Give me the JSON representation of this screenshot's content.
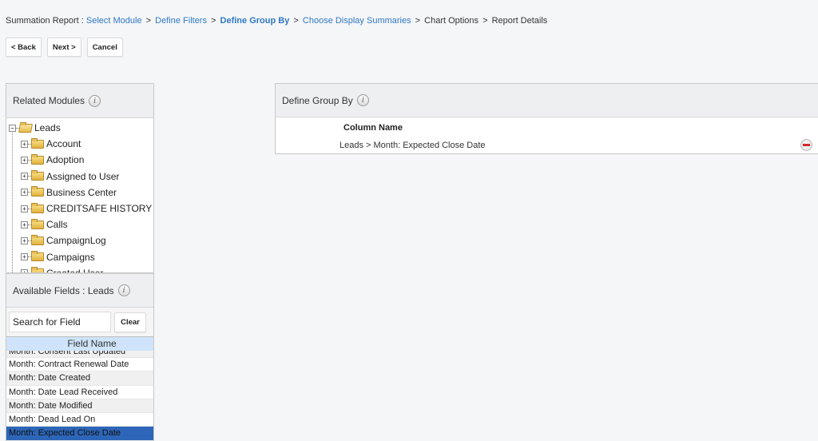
{
  "breadcrumb": {
    "prefix": "Summation Report :",
    "steps": [
      {
        "label": "Select Module",
        "state": "link"
      },
      {
        "label": "Define Filters",
        "state": "link"
      },
      {
        "label": "Define Group By",
        "state": "current"
      },
      {
        "label": "Choose Display Summaries",
        "state": "link"
      },
      {
        "label": "Chart Options",
        "state": "plain"
      },
      {
        "label": "Report Details",
        "state": "plain"
      }
    ],
    "separator": ">"
  },
  "buttons": {
    "back": "< Back",
    "next": "Next >",
    "cancel": "Cancel"
  },
  "related_modules": {
    "title": "Related Modules",
    "root": {
      "label": "Leads",
      "expanded": true,
      "expander": "−"
    },
    "children": [
      {
        "label": "Account",
        "expander": "+"
      },
      {
        "label": "Adoption",
        "expander": "+"
      },
      {
        "label": "Assigned to User",
        "expander": "+"
      },
      {
        "label": "Business Center",
        "expander": "+"
      },
      {
        "label": "CREDITSAFE HISTORY",
        "expander": "+"
      },
      {
        "label": "Calls",
        "expander": "+"
      },
      {
        "label": "CampaignLog",
        "expander": "+"
      },
      {
        "label": "Campaigns",
        "expander": "+"
      },
      {
        "label": "Created User",
        "expander": "+"
      }
    ]
  },
  "available_fields": {
    "title": "Available Fields : Leads",
    "search_placeholder": "Search for Field",
    "search_value": "",
    "clear_label": "Clear",
    "column_header": "Field Name",
    "rows": [
      {
        "label": "Month: Consent Last Updated",
        "partial": true
      },
      {
        "label": "Month: Contract Renewal Date"
      },
      {
        "label": "Month: Date Created"
      },
      {
        "label": "Month: Date Lead Received"
      },
      {
        "label": "Month: Date Modified"
      },
      {
        "label": "Month: Dead Lead On"
      },
      {
        "label": "Month: Expected Close Date",
        "selected": true
      }
    ]
  },
  "group_by": {
    "title": "Define Group By",
    "column_header": "Column Name",
    "rows": [
      {
        "label": "Leads > Month: Expected Close Date"
      }
    ]
  },
  "colors": {
    "link": "#2f78c4",
    "selected_row": "#2d66b8",
    "field_header": "#cfe4fa",
    "remove_icon": "#d12a2a"
  }
}
